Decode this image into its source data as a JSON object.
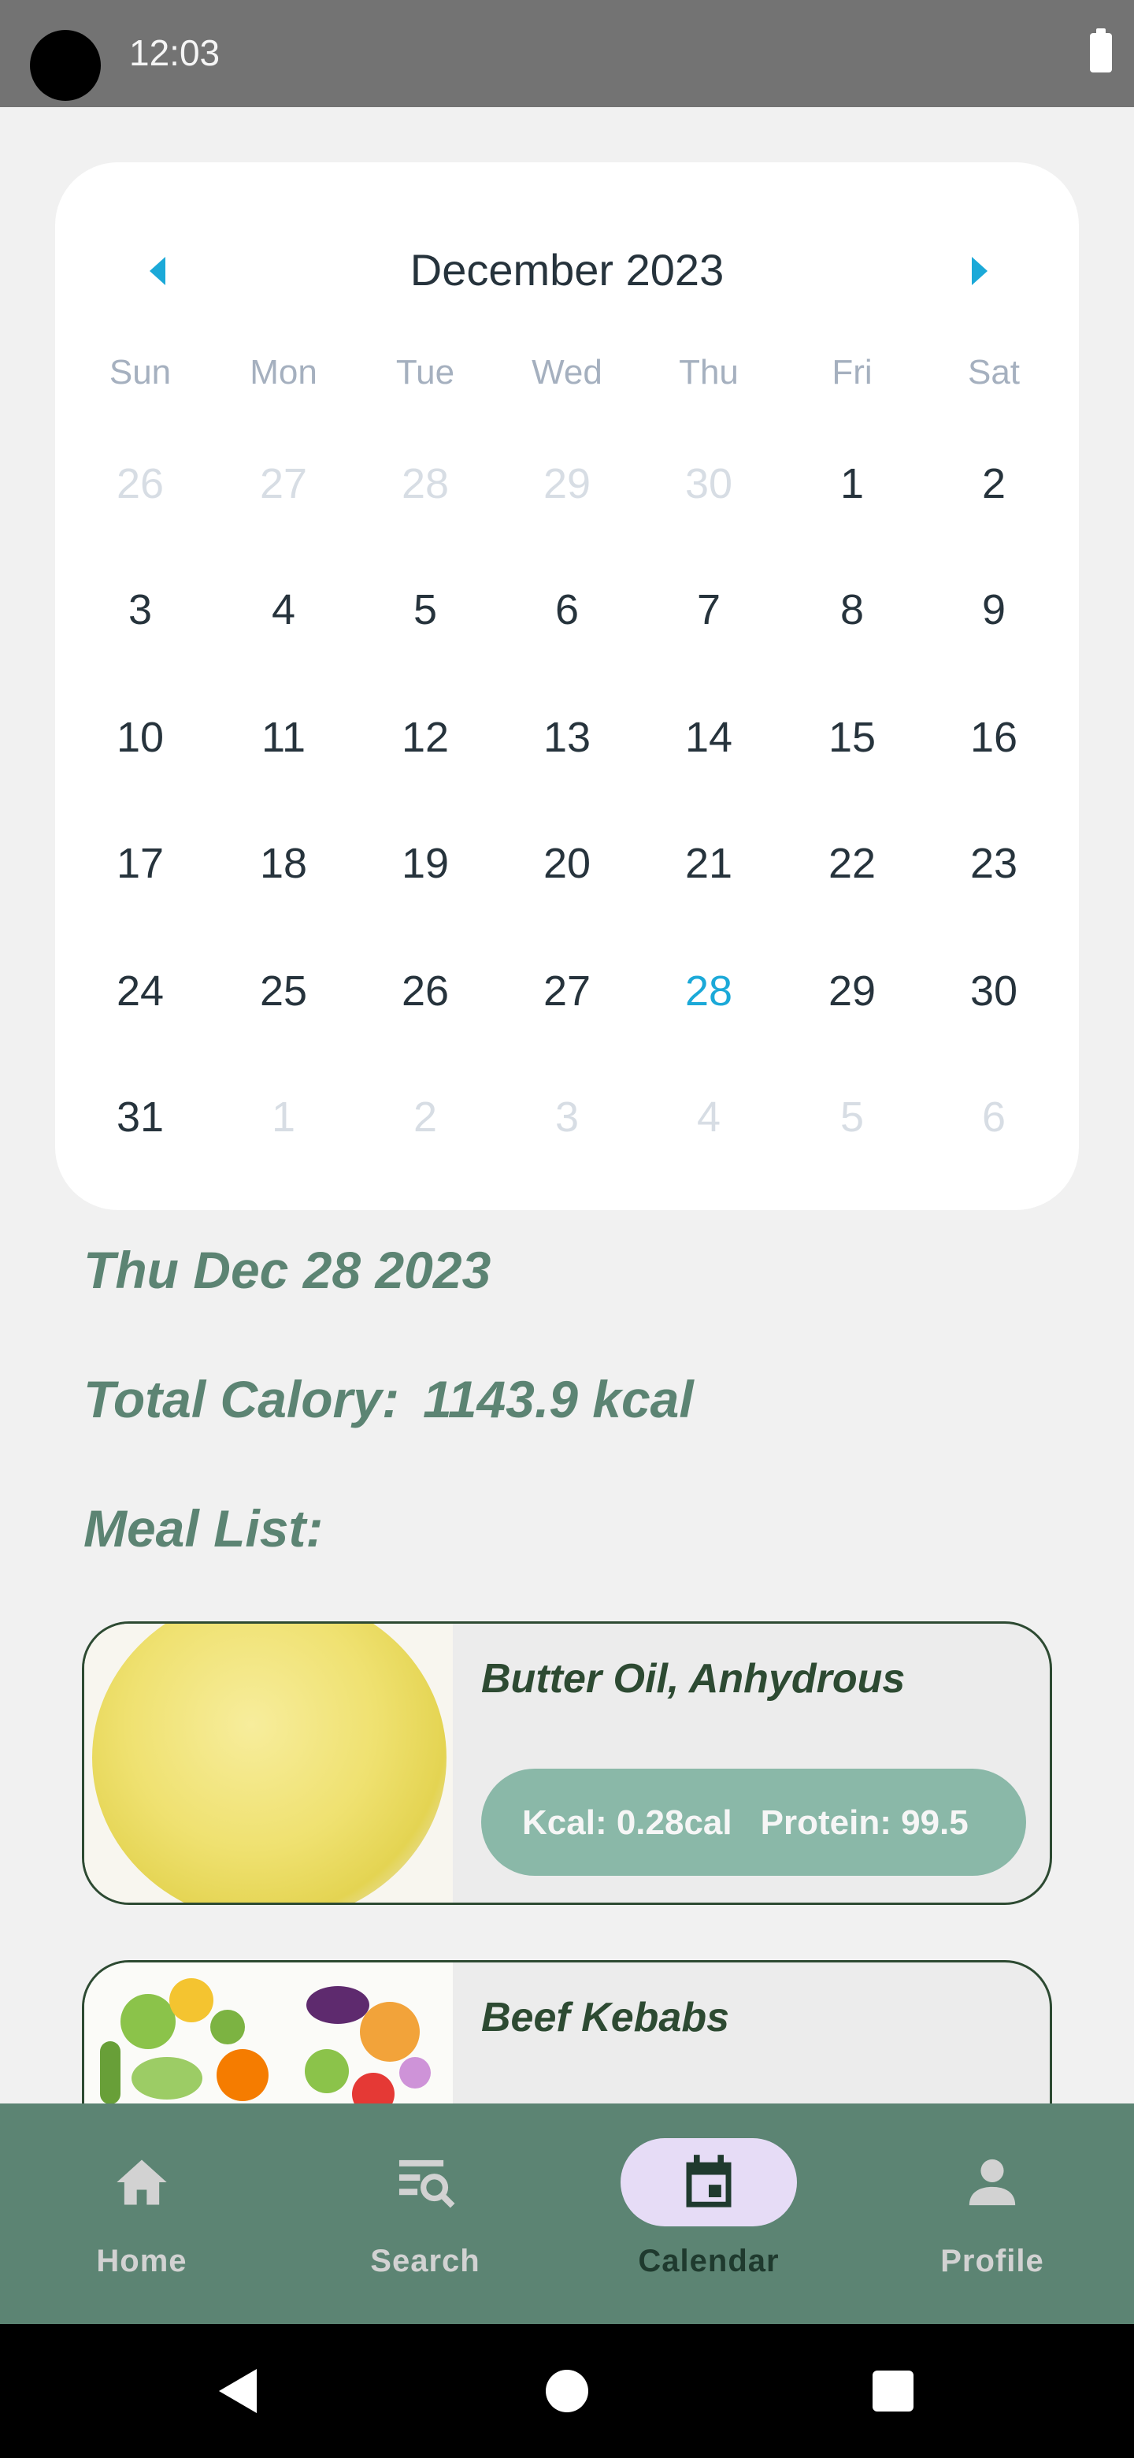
{
  "status_bar": {
    "time": "12:03",
    "battery_icon": "battery-full-icon"
  },
  "calendar": {
    "month_title": "December 2023",
    "prev_icon": "chevron-left-icon",
    "next_icon": "chevron-right-icon",
    "accent_color": "#1ba9d8",
    "weekdays": [
      "Sun",
      "Mon",
      "Tue",
      "Wed",
      "Thu",
      "Fri",
      "Sat"
    ],
    "weeks": [
      [
        {
          "d": "26",
          "muted": true
        },
        {
          "d": "27",
          "muted": true
        },
        {
          "d": "28",
          "muted": true
        },
        {
          "d": "29",
          "muted": true
        },
        {
          "d": "30",
          "muted": true
        },
        {
          "d": "1"
        },
        {
          "d": "2"
        }
      ],
      [
        {
          "d": "3"
        },
        {
          "d": "4"
        },
        {
          "d": "5"
        },
        {
          "d": "6"
        },
        {
          "d": "7"
        },
        {
          "d": "8"
        },
        {
          "d": "9"
        }
      ],
      [
        {
          "d": "10"
        },
        {
          "d": "11"
        },
        {
          "d": "12"
        },
        {
          "d": "13"
        },
        {
          "d": "14"
        },
        {
          "d": "15"
        },
        {
          "d": "16"
        }
      ],
      [
        {
          "d": "17"
        },
        {
          "d": "18"
        },
        {
          "d": "19"
        },
        {
          "d": "20"
        },
        {
          "d": "21"
        },
        {
          "d": "22"
        },
        {
          "d": "23"
        }
      ],
      [
        {
          "d": "24"
        },
        {
          "d": "25"
        },
        {
          "d": "26"
        },
        {
          "d": "27"
        },
        {
          "d": "28",
          "selected": true
        },
        {
          "d": "29"
        },
        {
          "d": "30"
        }
      ],
      [
        {
          "d": "31"
        },
        {
          "d": "1",
          "muted": true
        },
        {
          "d": "2",
          "muted": true
        },
        {
          "d": "3",
          "muted": true
        },
        {
          "d": "4",
          "muted": true
        },
        {
          "d": "5",
          "muted": true
        },
        {
          "d": "6",
          "muted": true
        }
      ]
    ]
  },
  "summary": {
    "selected_date": "Thu Dec 28 2023",
    "total_label": "Total Calory:",
    "total_value": "1143.9 kcal",
    "meal_list_heading": "Meal List:"
  },
  "meals": [
    {
      "name": "Butter Oil, Anhydrous",
      "kcal_label": "Kcal:",
      "kcal_value": "0.28cal",
      "protein_label": "Protein:",
      "protein_value": "99.5",
      "image": "butter-oil-photo"
    },
    {
      "name": "Beef Kebabs",
      "image": "vegetables-illustration"
    }
  ],
  "bottom_nav": {
    "items": [
      {
        "label": "Home",
        "icon": "home-icon"
      },
      {
        "label": "Search",
        "icon": "search-list-icon"
      },
      {
        "label": "Calendar",
        "icon": "calendar-icon",
        "active": true
      },
      {
        "label": "Profile",
        "icon": "person-icon"
      }
    ],
    "background": "#5c8473",
    "active_pill_color": "#e6dcf6"
  },
  "system_nav": {
    "back_icon": "back-triangle-icon",
    "home_icon": "home-circle-icon",
    "recents_icon": "recents-square-icon"
  }
}
